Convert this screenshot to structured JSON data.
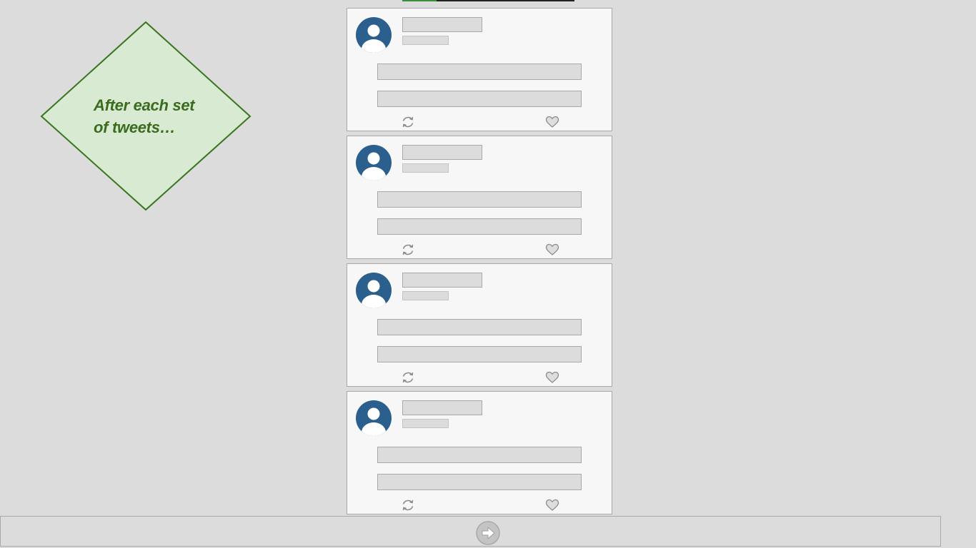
{
  "progress": {
    "fraction": 0.2
  },
  "callout": {
    "line1": "After each set",
    "line2": "of tweets…"
  },
  "tweets": [
    {
      "id": 1,
      "icons": [
        "avatar-icon",
        "retweet-icon",
        "like-icon"
      ]
    },
    {
      "id": 2,
      "icons": [
        "avatar-icon",
        "retweet-icon",
        "like-icon"
      ]
    },
    {
      "id": 3,
      "icons": [
        "avatar-icon",
        "retweet-icon",
        "like-icon"
      ]
    },
    {
      "id": 4,
      "icons": [
        "avatar-icon",
        "retweet-icon",
        "like-icon"
      ]
    }
  ],
  "bottom_bar": {
    "icon": "arrow-right-icon"
  },
  "colors": {
    "background": "#dcdcdc",
    "callout_fill": "#d9ead3",
    "callout_stroke": "#38761d",
    "callout_text": "#3a6b1e",
    "avatar": "#2b5f8d",
    "progress": "#3c8c3c"
  }
}
